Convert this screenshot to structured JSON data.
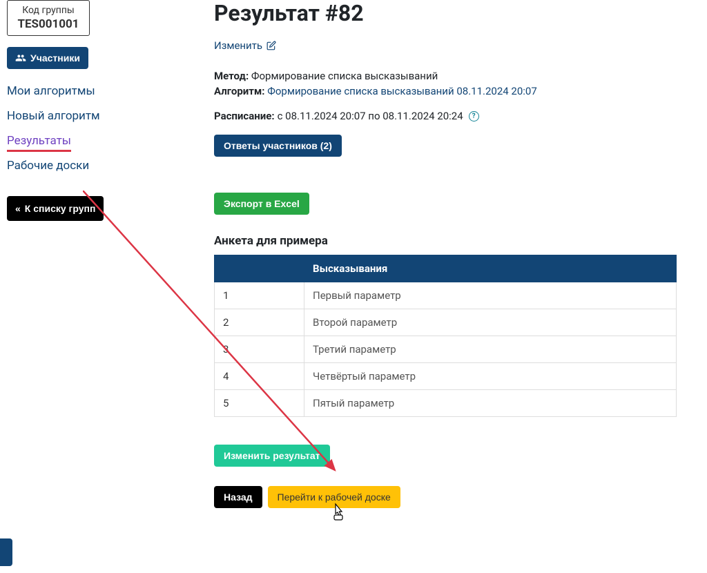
{
  "sidebar": {
    "group_code_label": "Код группы",
    "group_code_value": "TES001001",
    "participants_btn": "Участники",
    "back_to_groups_btn": "К списку групп",
    "nav": [
      {
        "label": "Мои алгоритмы",
        "active": false
      },
      {
        "label": "Новый алгоритм",
        "active": false
      },
      {
        "label": "Результаты",
        "active": true
      },
      {
        "label": "Рабочие доски",
        "active": false
      }
    ]
  },
  "page": {
    "title": "Результат #82",
    "change_link": "Изменить",
    "method_label": "Метод:",
    "method_value": "Формирование списка высказываний",
    "algorithm_label": "Алгоритм:",
    "algorithm_value": "Формирование списка высказываний 08.11.2024 20:07",
    "schedule_label": "Расписание:",
    "schedule_text": "с 08.11.2024 20:07 по 08.11.2024 20:24",
    "answers_btn": "Ответы участников (2)",
    "export_btn": "Экспорт в Excel",
    "table_title": "Анкета для примера",
    "table_header_num": "",
    "table_header_text": "Высказывания",
    "rows": [
      {
        "n": "1",
        "text": "Первый параметр"
      },
      {
        "n": "2",
        "text": "Второй параметр"
      },
      {
        "n": "3",
        "text": "Третий параметр"
      },
      {
        "n": "4",
        "text": "Четвёртый параметр"
      },
      {
        "n": "5",
        "text": "Пятый параметр"
      }
    ],
    "edit_result_btn": "Изменить результат",
    "back_btn": "Назад",
    "goto_board_btn": "Перейти к рабочей доске",
    "help_icon_text": "?"
  },
  "annotation": {
    "arrow_color": "#dc3545"
  }
}
